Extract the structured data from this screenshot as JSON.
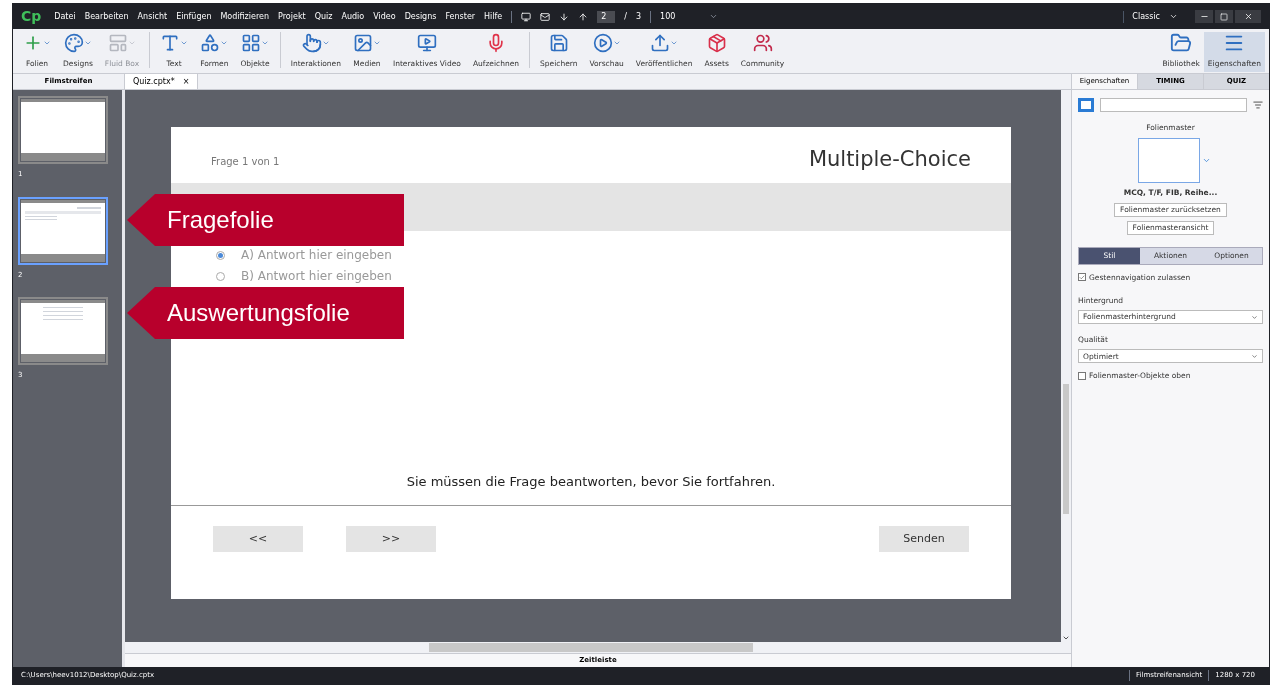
{
  "app": {
    "logo": "Cp",
    "menu": [
      "Datei",
      "Bearbeiten",
      "Ansicht",
      "Einfügen",
      "Modifizieren",
      "Projekt",
      "Quiz",
      "Audio",
      "Video",
      "Designs",
      "Fenster",
      "Hilfe"
    ],
    "slide_current": "2",
    "slide_separator": "/",
    "slide_total": "3",
    "zoom": "100",
    "workspace": "Classic"
  },
  "toolbar": [
    {
      "label": "Folien",
      "disabled": false
    },
    {
      "label": "Designs",
      "disabled": false
    },
    {
      "label": "Fluid Box",
      "disabled": true
    },
    {
      "label": "Text",
      "disabled": false
    },
    {
      "label": "Formen",
      "disabled": false
    },
    {
      "label": "Objekte",
      "disabled": false
    },
    {
      "label": "Interaktionen",
      "disabled": false
    },
    {
      "label": "Medien",
      "disabled": false
    },
    {
      "label": "Interaktives Video",
      "disabled": false
    },
    {
      "label": "Aufzeichnen",
      "disabled": false
    },
    {
      "label": "Speichern",
      "disabled": false
    },
    {
      "label": "Vorschau",
      "disabled": false
    },
    {
      "label": "Veröffentlichen",
      "disabled": false
    },
    {
      "label": "Assets",
      "disabled": false
    },
    {
      "label": "Community",
      "disabled": false
    }
  ],
  "toolbar_right": [
    {
      "label": "Bibliothek",
      "selected": false
    },
    {
      "label": "Eigenschaften",
      "selected": true
    }
  ],
  "filmstrip": {
    "title": "Filmstreifen",
    "slides": [
      {
        "number": "1",
        "kind": "blank",
        "selected": false
      },
      {
        "number": "2",
        "kind": "question",
        "selected": true
      },
      {
        "number": "3",
        "kind": "results",
        "selected": false
      }
    ]
  },
  "document_tab": {
    "title": "Quiz.cptx*",
    "close": "×"
  },
  "slide": {
    "counter": "Frage 1 von 1",
    "title": "Multiple-Choice",
    "answers": [
      {
        "text": "A) Antwort hier eingeben",
        "selected": true
      },
      {
        "text": "B) Antwort hier eingeben",
        "selected": false
      }
    ],
    "message": "Sie müssen die Frage beantworten, bevor Sie fortfahren.",
    "buttons": [
      "<<",
      ">>",
      "Senden"
    ]
  },
  "callouts": [
    {
      "label": "Fragefolie"
    },
    {
      "label": "Auswertungsfolie"
    }
  ],
  "timeline": "Zeitleiste",
  "properties": {
    "tabs": [
      {
        "label": "Eigenschaften",
        "selected": true
      },
      {
        "label": "TIMING",
        "selected": false
      },
      {
        "label": "QUIZ",
        "selected": false
      }
    ],
    "master_label": "Folienmaster",
    "master_name": "MCQ, T/F, FIB, Reihe...",
    "master_buttons": [
      "Folienmaster zurücksetzen",
      "Folienmasteransicht"
    ],
    "subtabs": [
      {
        "label": "Stil",
        "selected": true
      },
      {
        "label": "Aktionen",
        "selected": false
      },
      {
        "label": "Optionen",
        "selected": false
      }
    ],
    "gesture": {
      "label": "Gestennavigation zulassen",
      "checked": true
    },
    "background_label": "Hintergrund",
    "background_value": "Folienmasterhintergrund",
    "quality_label": "Qualität",
    "quality_value": "Optimiert",
    "master_objects": {
      "label": "Folienmaster-Objekte oben",
      "checked": false
    }
  },
  "status_bar": {
    "path": "C:\\Users\\heev1012\\Desktop\\Quiz.cptx",
    "view": "Filmstreifenansicht",
    "size": "1280 x 720"
  }
}
